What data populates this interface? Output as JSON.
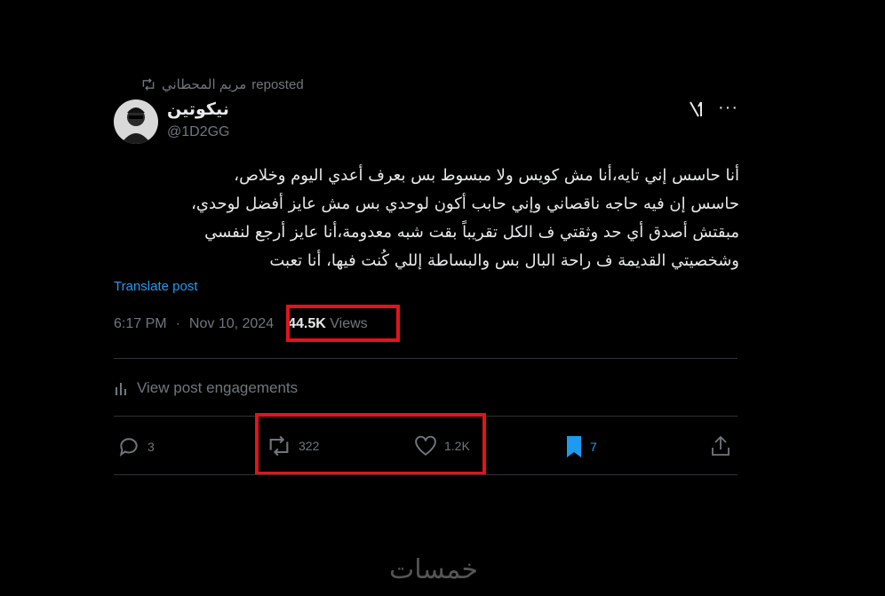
{
  "repost": {
    "reposter": "مريم المحطاني",
    "label": "reposted"
  },
  "author": {
    "display_name": "نيكوتين",
    "handle": "@1D2GG"
  },
  "post": {
    "lines": [
      "أنا حاسس إني تايه،أنا مش كويس ولا مبسوط بس بعرف أعدي اليوم وخلاص،",
      "حاسس إن فيه حاجه ناقصاني وإني حابب أكون لوحدي بس مش عايز أفضل لوحدي،",
      "مبقتش أصدق أي حد وثقتي ف الكل تقريباً بقت شبه معدومة،أنا عايز أرجع لنفسي",
      "وشخصيتي القديمة ف راحة البال بس والبساطة إللي كُنت فيها، أنا تعبت"
    ],
    "translate_label": "Translate post"
  },
  "meta": {
    "time": "6:17 PM",
    "separator": "·",
    "date": "Nov 10, 2024",
    "views_count": "44.5K",
    "views_label": "Views"
  },
  "engagements_label": "View post engagements",
  "actions": {
    "replies": "3",
    "reposts": "322",
    "likes": "1.2K",
    "bookmarks": "7"
  },
  "colors": {
    "accent": "#1d9bf0",
    "highlight": "#e3131a",
    "muted": "#71767b"
  },
  "watermark": "خمسات"
}
